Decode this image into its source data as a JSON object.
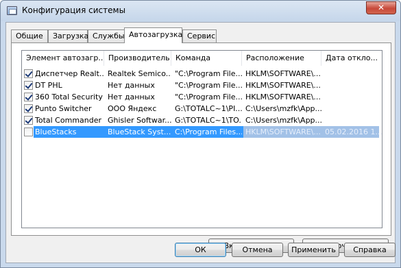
{
  "window": {
    "title": "Конфигурация системы",
    "close_label": "✕"
  },
  "tabs": [
    {
      "label": "Общие"
    },
    {
      "label": "Загрузка"
    },
    {
      "label": "Службы"
    },
    {
      "label": "Автозагрузка",
      "active": true
    },
    {
      "label": "Сервис"
    }
  ],
  "table": {
    "columns": [
      "Элемент автозагр...",
      "Производитель",
      "Команда",
      "Расположение",
      "Дата откло..."
    ],
    "rows": [
      {
        "checked": true,
        "name": "Диспетчер Realt...",
        "vendor": "Realtek Semico...",
        "command": "\"C:\\Program File...",
        "location": "HKLM\\SOFTWARE\\...",
        "date": ""
      },
      {
        "checked": true,
        "name": "DT PHL",
        "vendor": "Нет данных",
        "command": "\"C:\\Program File...",
        "location": "HKLM\\SOFTWARE\\...",
        "date": ""
      },
      {
        "checked": true,
        "name": "360 Total Security",
        "vendor": "Нет данных",
        "command": "\"C:\\Program File...",
        "location": "HKLM\\SOFTWARE\\...",
        "date": ""
      },
      {
        "checked": true,
        "name": "Punto Switcher",
        "vendor": "ООО Яндекс",
        "command": "G:\\TOTALC~1\\PI...",
        "location": "C:\\Users\\mzfk\\App...",
        "date": ""
      },
      {
        "checked": true,
        "name": "Total Commander",
        "vendor": "Ghisler Softwar...",
        "command": "G:\\TOTALC~1\\TO...",
        "location": "C:\\Users\\mzfk\\App...",
        "date": ""
      },
      {
        "checked": false,
        "name": "BlueStacks",
        "vendor": "BlueStack Syst...",
        "command": "C:\\Program Files...",
        "location": "HKLM\\SOFTWARE\\...",
        "date": "05.02.2016 1...",
        "selected": true
      }
    ]
  },
  "buttons": {
    "enable_all": "Включить все",
    "disable_all": "Отключить все",
    "ok": "ОК",
    "cancel": "Отмена",
    "apply": "Применить",
    "help": "Справка"
  }
}
